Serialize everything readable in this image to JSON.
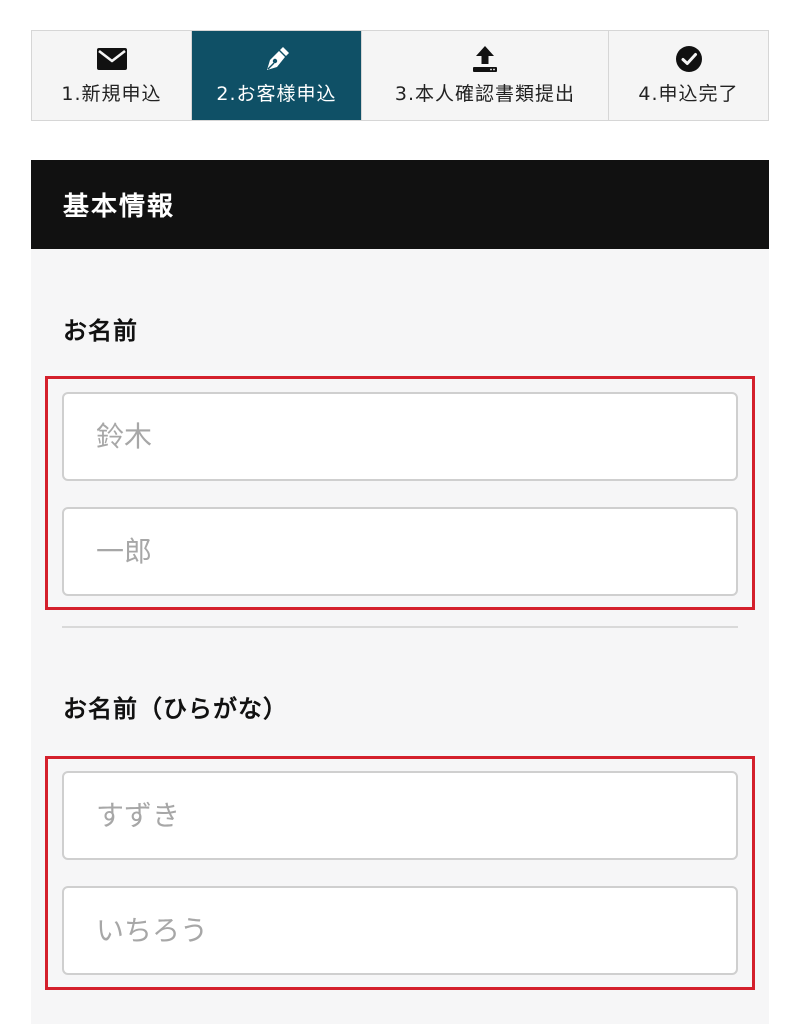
{
  "steps": [
    {
      "label": "1.新規申込",
      "icon": "envelope-icon",
      "active": false
    },
    {
      "label": "2.お客様申込",
      "icon": "pen-icon",
      "active": true
    },
    {
      "label": "3.本人確認書類提出",
      "icon": "upload-icon",
      "active": false
    },
    {
      "label": "4.申込完了",
      "icon": "check-circle-icon",
      "active": false
    }
  ],
  "section": {
    "title": "基本情報"
  },
  "name": {
    "label": "お名前",
    "last_name_placeholder": "鈴木",
    "first_name_placeholder": "一郎"
  },
  "name_kana": {
    "label": "お名前（ひらがな）",
    "last_name_placeholder": "すずき",
    "first_name_placeholder": "いちろう"
  },
  "colors": {
    "active_step": "#0f5066",
    "header_bg": "#111111",
    "highlight": "#d4202c"
  }
}
